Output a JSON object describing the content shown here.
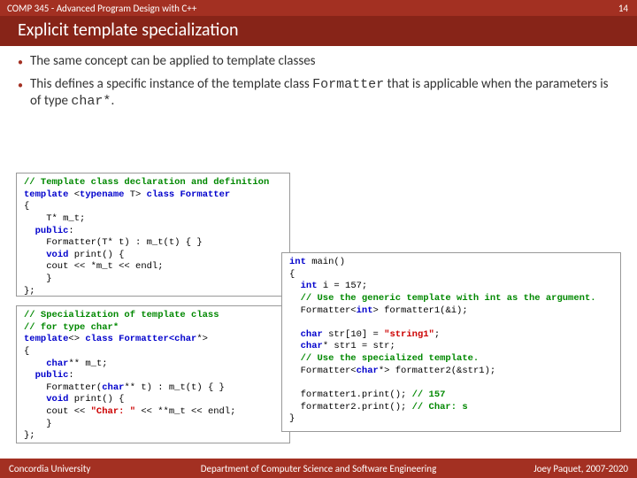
{
  "course": "COMP 345 - Advanced Program Design with C++",
  "slideNum": "14",
  "slideTitle": "Explicit template specialization",
  "bullet1": "The same concept can be applied to template classes",
  "bullet2a": "This defines a specific instance of the template class ",
  "bullet2b": "Formatter",
  "bullet2c": " that is applicable when the parameters is of type ",
  "bullet2d": "char*",
  "bullet2e": ".",
  "footer": {
    "left": "Concordia University",
    "center": "Department of Computer Science and Software Engineering",
    "right": "Joey Paquet, 2007-2020"
  },
  "code1": {
    "c1": "// Template class declaration and definition",
    "l2a": "template",
    "l2b": " <",
    "l2c": "typename",
    "l2d": " T> ",
    "l2e": "class",
    "l2f": " Formatter",
    "l3": "{",
    "l4": "    T* m_t;",
    "l5a": "  ",
    "l5b": "public",
    "l5c": ":",
    "l6": "    Formatter(T* t) : m_t(t) { }",
    "l7a": "    ",
    "l7b": "void",
    "l7c": " print() {",
    "l8": "    cout << *m_t << endl;",
    "l9": "    }",
    "l10": "};"
  },
  "code2": {
    "c1": "// Specialization of template class",
    "c2": "// for type char*",
    "l3a": "template",
    "l3b": "<> ",
    "l3c": "class",
    "l3d": " Formatter<",
    "l3e": "char",
    "l3f": "*>",
    "l4": "{",
    "l5a": "    ",
    "l5b": "char",
    "l5c": "** m_t;",
    "l6a": "  ",
    "l6b": "public",
    "l6c": ":",
    "l7a": "    Formatter(",
    "l7b": "char",
    "l7c": "** t) : m_t(t) { }",
    "l8a": "    ",
    "l8b": "void",
    "l8c": " print() {",
    "l9a": "    cout << ",
    "l9b": "\"Char: \"",
    "l9c": " << **m_t << endl;",
    "l10": "    }",
    "l11": "};"
  },
  "code3": {
    "l1a": "int",
    "l1b": " main()",
    "l2": "{",
    "l3a": "  ",
    "l3b": "int",
    "l3c": " i = 157;",
    "c4": "  // Use the generic template with int as the argument.",
    "l5a": "  Formatter<",
    "l5b": "int",
    "l5c": "> formatter1(&i);",
    "b1": " ",
    "l7a": "  ",
    "l7b": "char",
    "l7c": " str[10] = ",
    "l7d": "\"string1\"",
    "l7e": ";",
    "l8a": "  ",
    "l8b": "char",
    "l8c": "* str1 = str;",
    "c9": "  // Use the specialized template.",
    "l10a": "  Formatter<",
    "l10b": "char",
    "l10c": "*> formatter2(&str1);",
    "b2": " ",
    "l12a": "  formatter1.print(); ",
    "l12b": "// 157",
    "l13a": "  formatter2.print(); ",
    "l13b": "// Char: s",
    "l14": "}"
  }
}
